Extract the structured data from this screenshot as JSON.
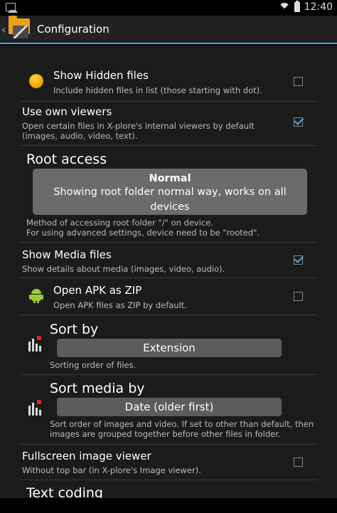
{
  "status_bar": {
    "time": "12:40"
  },
  "action_bar": {
    "title": "Configuration"
  },
  "settings": [
    {
      "title": "Show Hidden files",
      "subtitle": "Include hidden files in list (those starting with dot).",
      "checked": false
    },
    {
      "title": "Use own viewers",
      "subtitle_lines": [
        "Open certain files in X-plore's internal viewers by default",
        "(images, audio, video, text)."
      ],
      "checked": true
    },
    {
      "title": "Root access",
      "selector_title": "Normal",
      "selector_desc_lines": [
        "Showing root folder normal way, works on all",
        "devices"
      ],
      "subtitle_lines": [
        "Method of accessing root folder \"/\" on device.",
        "For using advanced settings, device need to be \"rooted\"."
      ]
    },
    {
      "title": "Show Media files",
      "subtitle": "Show details about media (images, video, audio).",
      "checked": true
    },
    {
      "title": "Open APK as ZIP",
      "subtitle": "Open APK files as ZIP by default.",
      "checked": false
    },
    {
      "title": "Sort by",
      "value": "Extension",
      "subtitle": "Sorting order of files."
    },
    {
      "title": "Sort media by",
      "value": "Date (older first)",
      "subtitle_lines": [
        "Sort order of images and video. If set to other than default, then",
        "images are grouped together before other files in folder."
      ]
    },
    {
      "title": "Fullscreen image viewer",
      "subtitle": "Without top bar (in X-plore's Image viewer).",
      "checked": false
    },
    {
      "title": "Text coding"
    }
  ]
}
